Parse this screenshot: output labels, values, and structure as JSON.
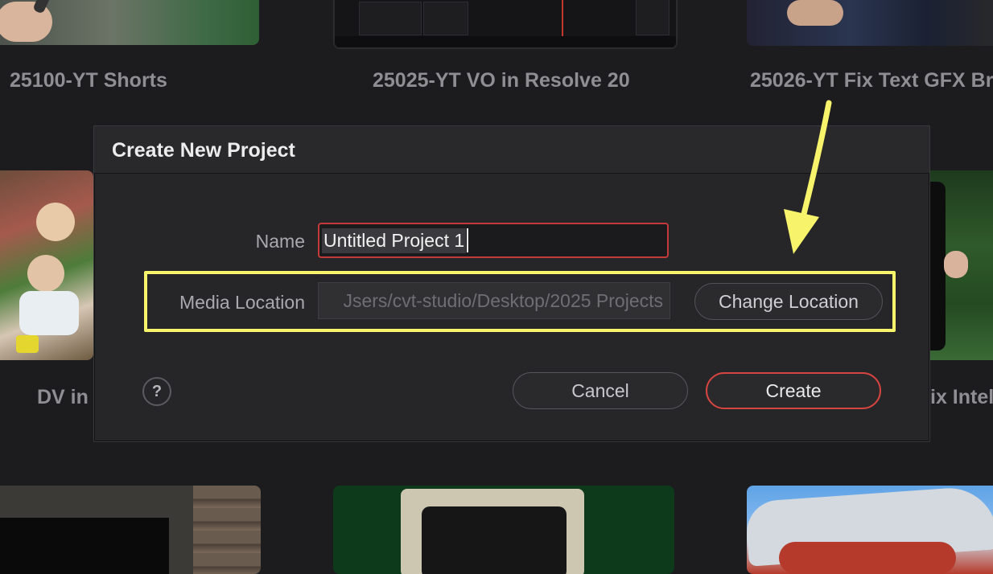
{
  "background_projects": {
    "row1": [
      {
        "title": "25100-YT Shorts"
      },
      {
        "title": "25025-YT VO in Resolve 20"
      },
      {
        "title": "25026-YT Fix Text GFX Br"
      }
    ],
    "row2": [
      {
        "title": "DV in"
      },
      {
        "title": "ix Intel"
      }
    ]
  },
  "dialog": {
    "title": "Create New Project",
    "name_label": "Name",
    "name_value": "Untitled Project 1",
    "media_location_label": "Media Location",
    "media_location_value": "Jsers/cvt-studio/Desktop/2025 Projects",
    "change_location_label": "Change Location",
    "help_label": "?",
    "cancel_label": "Cancel",
    "create_label": "Create"
  },
  "annotation": {
    "highlight_color": "#f7f36a",
    "arrow_color": "#f7f36a"
  },
  "colors": {
    "accent_red": "#d6453f",
    "dialog_bg": "#262629",
    "page_bg": "#1c1c1f"
  }
}
